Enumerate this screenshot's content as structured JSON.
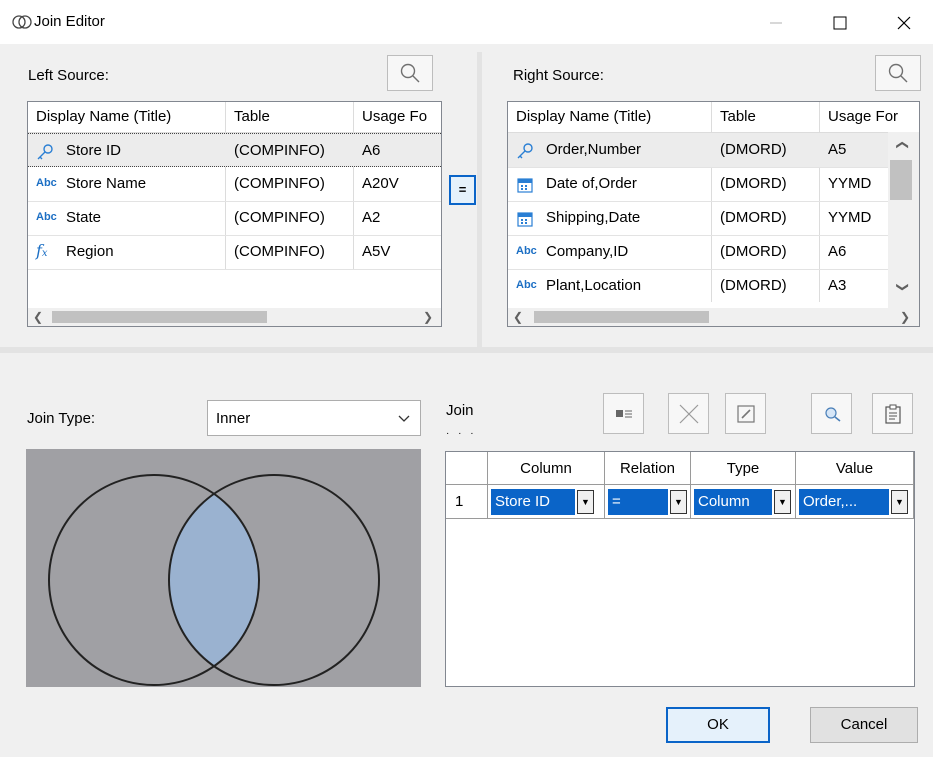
{
  "window": {
    "title": "Join Editor"
  },
  "left": {
    "label": "Left Source:",
    "columns": [
      "Display Name (Title)",
      "Table",
      "Usage Fo"
    ],
    "rows": [
      {
        "icon": "key-icon",
        "name": "Store ID",
        "table": "(COMPINFO)",
        "usage": "A6"
      },
      {
        "icon": "abc-icon",
        "name": "Store Name",
        "table": "(COMPINFO)",
        "usage": "A20V"
      },
      {
        "icon": "abc-icon",
        "name": "State",
        "table": "(COMPINFO)",
        "usage": "A2"
      },
      {
        "icon": "function-icon",
        "name": "Region",
        "table": "(COMPINFO)",
        "usage": "A5V"
      }
    ]
  },
  "right": {
    "label": "Right Source:",
    "columns": [
      "Display Name (Title)",
      "Table",
      "Usage For"
    ],
    "rows": [
      {
        "icon": "key-icon",
        "name": "Order,Number",
        "table": "(DMORD)",
        "usage": "A5"
      },
      {
        "icon": "calendar-icon",
        "name": "Date of,Order",
        "table": "(DMORD)",
        "usage": "YYMD"
      },
      {
        "icon": "calendar-icon",
        "name": "Shipping,Date",
        "table": "(DMORD)",
        "usage": "YYMD"
      },
      {
        "icon": "abc-icon",
        "name": "Company,ID",
        "table": "(DMORD)",
        "usage": "A6"
      },
      {
        "icon": "abc-icon",
        "name": "Plant,Location",
        "table": "(DMORD)",
        "usage": "A3"
      }
    ]
  },
  "equals_label": "=",
  "join_type": {
    "label": "Join Type:",
    "value": "Inner"
  },
  "conditions": {
    "label": "Join",
    "columns": [
      "Column",
      "Relation",
      "Type",
      "Value"
    ],
    "rows": [
      {
        "num": "1",
        "column": "Store ID",
        "relation": "=",
        "type": "Column",
        "value": "Order,..."
      }
    ]
  },
  "buttons": {
    "ok": "OK",
    "cancel": "Cancel"
  },
  "colors": {
    "accent": "#0a64c8",
    "venn_bg": "#a0a0a4",
    "venn_overlap": "#9ab2d0"
  }
}
